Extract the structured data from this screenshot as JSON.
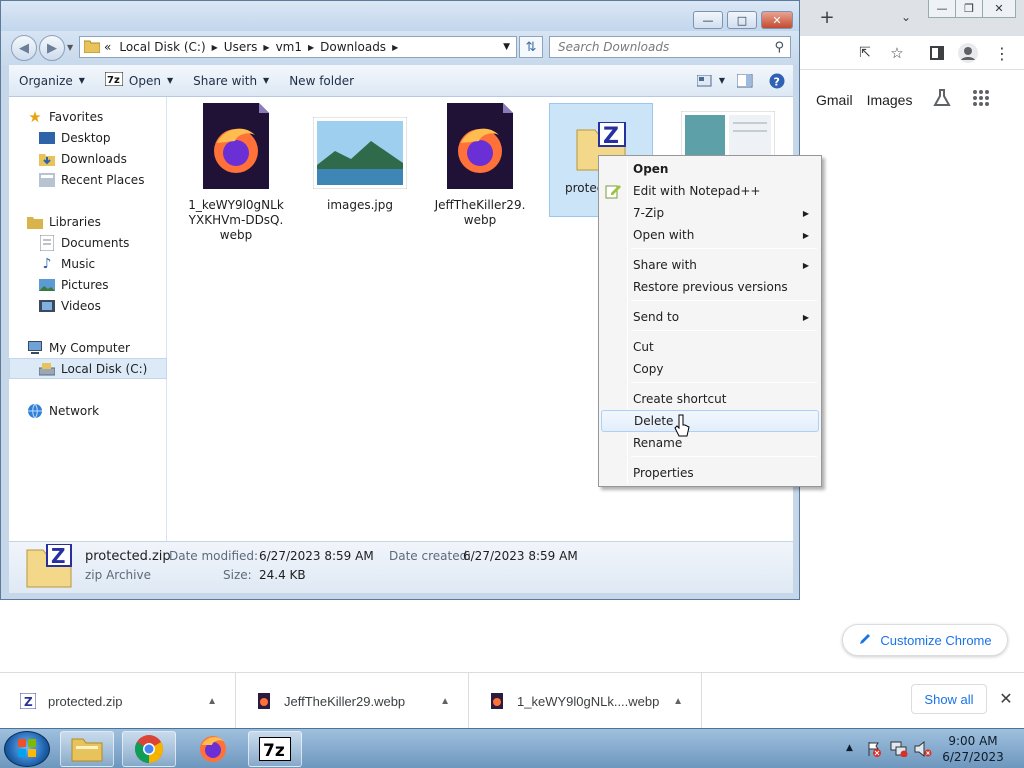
{
  "chrome": {
    "new_tab": "+",
    "google_links": [
      "Gmail",
      "Images"
    ],
    "customize_label": "Customize Chrome",
    "downloads": [
      {
        "name": "protected.zip",
        "icon": "zip-icon"
      },
      {
        "name": "JeffTheKiller29.webp",
        "icon": "webp-icon"
      },
      {
        "name": "1_keWY9l0gNLk....webp",
        "icon": "webp-icon"
      }
    ],
    "show_all": "Show all"
  },
  "explorer": {
    "address": {
      "prefix": "«",
      "crumbs": [
        "Local Disk (C:)",
        "Users",
        "vm1",
        "Downloads"
      ]
    },
    "search_placeholder": "Search Downloads",
    "toolbar": {
      "organize": "Organize",
      "open": "Open",
      "share_with": "Share with",
      "new_folder": "New folder"
    },
    "nav": {
      "favorites": "Favorites",
      "desktop": "Desktop",
      "downloads": "Downloads",
      "recent": "Recent Places",
      "libraries": "Libraries",
      "documents": "Documents",
      "music": "Music",
      "pictures": "Pictures",
      "videos": "Videos",
      "my_computer": "My Computer",
      "local_disk": "Local Disk (C:)",
      "network": "Network"
    },
    "files": [
      {
        "label": "1_keWY9l0gNLkYXKHVm-DDsQ.webp"
      },
      {
        "label": "images.jpg"
      },
      {
        "label": "JeffTheKiller29.webp"
      },
      {
        "label": "protec"
      },
      {
        "label": ""
      }
    ],
    "details": {
      "name": "protected.zip",
      "type": "zip Archive",
      "modified_label": "Date modified:",
      "modified": "6/27/2023 8:59 AM",
      "created_label": "Date created:",
      "created": "6/27/2023 8:59 AM",
      "size_label": "Size:",
      "size": "24.4 KB"
    }
  },
  "context_menu": {
    "items": [
      {
        "label": "Open"
      },
      {
        "label": "Edit with Notepad++"
      },
      {
        "label": "7-Zip"
      },
      {
        "label": "Open with"
      },
      {
        "label": "Share with"
      },
      {
        "label": "Restore previous versions"
      },
      {
        "label": "Send to"
      },
      {
        "label": "Cut"
      },
      {
        "label": "Copy"
      },
      {
        "label": "Create shortcut"
      },
      {
        "label": "Delete"
      },
      {
        "label": "Rename"
      },
      {
        "label": "Properties"
      }
    ]
  },
  "taskbar": {
    "time": "9:00 AM",
    "date": "6/27/2023"
  },
  "colors": {
    "accent_blue": "#1a73e8",
    "selection": "#cce4f7",
    "taskbar": "#7fa6cb"
  }
}
